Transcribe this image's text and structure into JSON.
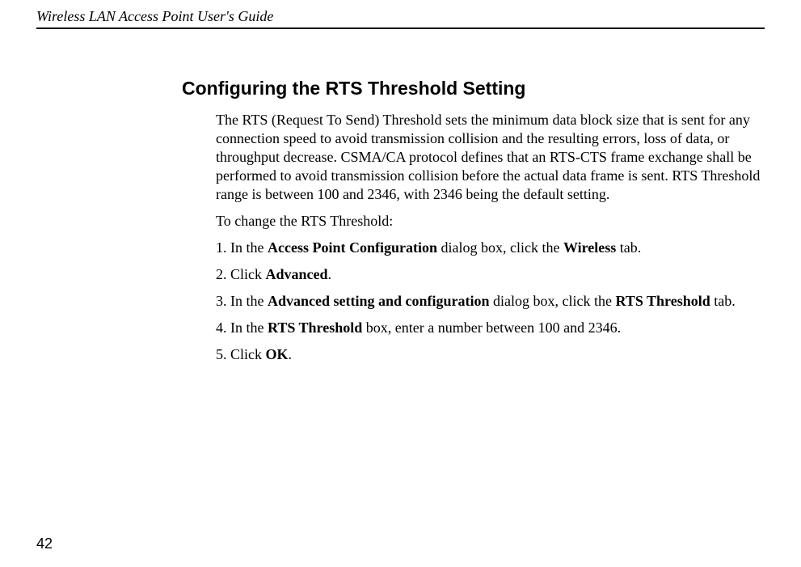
{
  "header": {
    "title": "Wireless LAN Access Point User's Guide"
  },
  "section": {
    "title": "Configuring the RTS Threshold Setting"
  },
  "paragraphs": {
    "intro": "The RTS (Request To Send) Threshold sets the minimum data block size that is sent for any connection speed to avoid transmission collision and the resulting errors, loss of data, or throughput decrease. CSMA/CA protocol defines that an RTS-CTS frame exchange shall be performed to avoid transmission collision before the actual data frame is sent. RTS Threshold range is between 100 and 2346, with 2346 being the default setting.",
    "lead": "To change the RTS Threshold:"
  },
  "steps": {
    "s1": {
      "num": "1.",
      "t1": "In the ",
      "b1": "Access Point Configuration",
      "t2": " dialog box, click the ",
      "b2": "Wireless",
      "t3": " tab."
    },
    "s2": {
      "num": "2.",
      "t1": "Click ",
      "b1": "Advanced",
      "t2": "."
    },
    "s3": {
      "num": "3.",
      "t1": "In the ",
      "b1": "Advanced setting and configuration",
      "t2": " dialog box, click the ",
      "b2": "RTS Threshold",
      "t3": " tab."
    },
    "s4": {
      "num": "4.",
      "t1": "In the ",
      "b1": "RTS Threshold",
      "t2": " box, enter a number between 100 and 2346."
    },
    "s5": {
      "num": "5.",
      "t1": "Click ",
      "b1": "OK",
      "t2": "."
    }
  },
  "page_number": "42"
}
